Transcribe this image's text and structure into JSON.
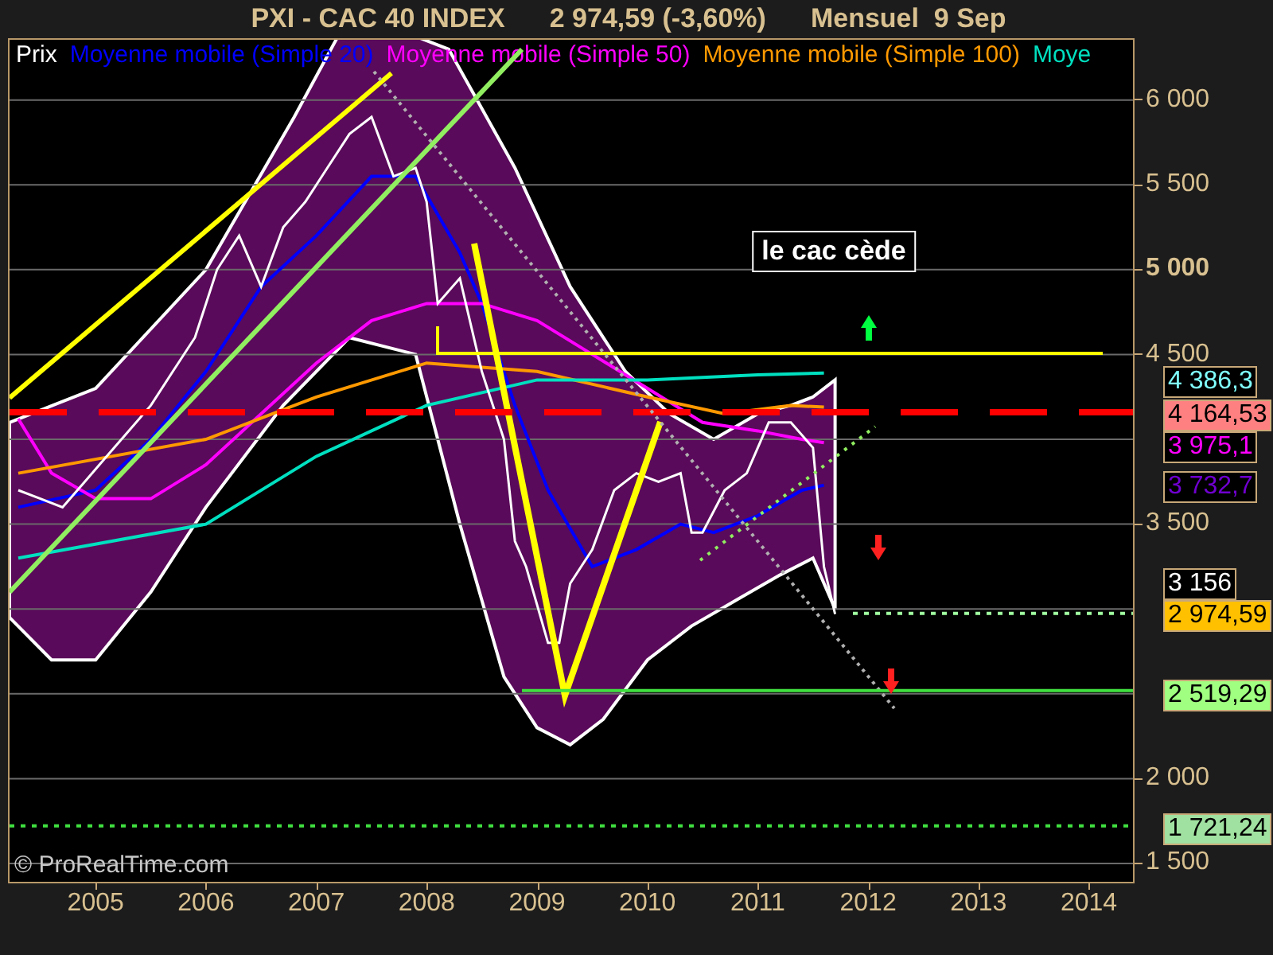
{
  "header": {
    "symbol": "PXI - CAC 40 INDEX",
    "quote": "2 974,59 (-3,60%)",
    "period": "Mensuel  9 Sep"
  },
  "chart": {
    "credit": "© ProRealTime.com",
    "chart_data": {
      "type": "line",
      "grid": true,
      "xlim": [
        2004.22,
        2014.4
      ],
      "ylim": [
        1392,
        6355
      ],
      "xticks": [
        2005,
        2006,
        2007,
        2008,
        2009,
        2010,
        2011,
        2012,
        2013,
        2014
      ],
      "yticks": [
        {
          "value": 6000,
          "label": "6 000"
        },
        {
          "value": 5500,
          "label": "5 500"
        },
        {
          "value": 5000,
          "label": "**5 000**"
        },
        {
          "value": 4500,
          "label": "4 500"
        },
        {
          "value": 3500,
          "label": "3 500"
        },
        {
          "value": 2000,
          "label": "2 000"
        },
        {
          "value": 1500,
          "label": "1 500"
        }
      ],
      "series": [
        {
          "name": "Prix",
          "color": "#ffffff",
          "x": [
            2004.3,
            2004.5,
            2004.7,
            2004.9,
            2005.1,
            2005.3,
            2005.5,
            2005.7,
            2005.9,
            2006.1,
            2006.3,
            2006.5,
            2006.7,
            2006.9,
            2007.1,
            2007.3,
            2007.5,
            2007.7,
            2007.9,
            2008.0,
            2008.1,
            2008.3,
            2008.5,
            2008.7,
            2008.8,
            2008.9,
            2009.1,
            2009.2,
            2009.3,
            2009.5,
            2009.7,
            2009.9,
            2010.1,
            2010.3,
            2010.4,
            2010.5,
            2010.7,
            2010.9,
            2011.1,
            2011.3,
            2011.5,
            2011.6,
            2011.7
          ],
          "values": [
            3700,
            3650,
            3600,
            3750,
            3900,
            4050,
            4200,
            4400,
            4600,
            5000,
            5200,
            4900,
            5250,
            5400,
            5600,
            5800,
            5900,
            5550,
            5600,
            5400,
            4800,
            4950,
            4400,
            4000,
            3400,
            3250,
            2800,
            2800,
            3150,
            3350,
            3700,
            3800,
            3750,
            3800,
            3450,
            3450,
            3700,
            3800,
            4100,
            4100,
            3950,
            3250,
            2970
          ]
        },
        {
          "name": "Moyenne mobile (Simple 20)",
          "color": "#0000ff",
          "x": [
            2004.3,
            2005,
            2005.5,
            2006,
            2006.5,
            2007,
            2007.5,
            2007.9,
            2008.3,
            2008.5,
            2008.8,
            2009.1,
            2009.5,
            2009.9,
            2010.3,
            2010.6,
            2011,
            2011.4,
            2011.6
          ],
          "values": [
            3600,
            3700,
            4000,
            4400,
            4900,
            5200,
            5550,
            5550,
            5100,
            4800,
            4200,
            3700,
            3250,
            3350,
            3500,
            3450,
            3550,
            3700,
            3730
          ]
        },
        {
          "name": "Moyenne mobile (Simple 50)",
          "color": "#ff00ff",
          "x": [
            2004.3,
            2004.6,
            2005,
            2005.5,
            2006,
            2006.5,
            2007,
            2007.5,
            2008,
            2008.5,
            2009,
            2009.5,
            2010,
            2010.5,
            2011,
            2011.4,
            2011.6
          ],
          "values": [
            4120,
            3800,
            3650,
            3650,
            3850,
            4150,
            4450,
            4700,
            4800,
            4800,
            4700,
            4500,
            4300,
            4100,
            4050,
            4000,
            3980
          ]
        },
        {
          "name": "Moyenne mobile (Simple 100)",
          "color": "#ff9900",
          "x": [
            2004.3,
            2006,
            2007,
            2008,
            2009,
            2010,
            2010.7,
            2011.3,
            2011.6
          ],
          "values": [
            3800,
            4000,
            4250,
            4450,
            4400,
            4250,
            4150,
            4200,
            4190
          ]
        },
        {
          "name": "Moye",
          "color": "#00e0c0",
          "x": [
            2004.3,
            2006,
            2007,
            2008,
            2009,
            2010,
            2011,
            2011.6
          ],
          "values": [
            3300,
            3500,
            3900,
            4200,
            4350,
            4350,
            4380,
            4390
          ]
        }
      ],
      "annotations": [
        {
          "text": "le cac cède"
        }
      ]
    }
  },
  "price_labels": [
    {
      "kind": "outlined",
      "text": "4 386,3",
      "color": "#80ffff"
    },
    {
      "kind": "filled",
      "text": "4 164,53",
      "color": "#ff8080"
    },
    {
      "kind": "outlined",
      "text": "3 975,1",
      "color": "#ff00ff"
    },
    {
      "kind": "outlined",
      "text": "3 732,7",
      "color": "#7000d0"
    },
    {
      "kind": "outlined",
      "text": "3 156",
      "color": "#ffffff"
    },
    {
      "kind": "filled",
      "text": "2 974,59",
      "color": "#ffc000"
    },
    {
      "kind": "filled",
      "text": "2 519,29",
      "color": "#a0ff80"
    },
    {
      "kind": "filled",
      "text": "1 721,24",
      "color": "#a0e0a0"
    }
  ]
}
